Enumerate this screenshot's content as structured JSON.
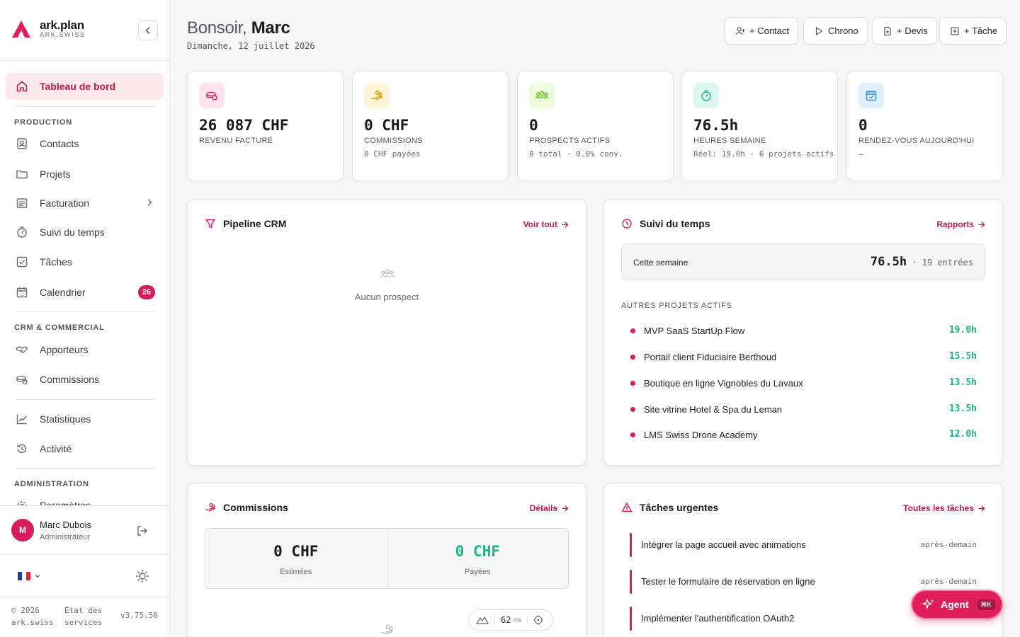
{
  "brand": {
    "name": "ark.plan",
    "sub": "ARK.SWISS"
  },
  "nav": {
    "dashboard": "Tableau de bord",
    "sections": {
      "production": "PRODUCTION",
      "crm": "CRM & COMMERCIAL",
      "admin": "ADMINISTRATION"
    },
    "contacts": "Contacts",
    "projects": "Projets",
    "billing": "Facturation",
    "time": "Suivi du temps",
    "tasks": "Tâches",
    "calendar": "Calendrier",
    "calendar_badge": "26",
    "referrers": "Apporteurs",
    "commissions": "Commissions",
    "stats": "Statistiques",
    "activity": "Activité",
    "settings": "Paramètres"
  },
  "user": {
    "initial": "M",
    "name": "Marc Dubois",
    "role": "Administrateur"
  },
  "footer": {
    "copyright": "© 2026",
    "domain": "ark.swiss",
    "status1": "État des",
    "status2": "services",
    "version": "v3.75.56"
  },
  "header": {
    "greeting": "Bonsoir,",
    "user_name": "Marc",
    "date": "Dimanche, 12 juillet 2026",
    "buttons": {
      "contact": "+ Contact",
      "chrono": "Chrono",
      "quote": "+ Devis",
      "task": "+ Tâche"
    }
  },
  "kpis": [
    {
      "value": "26 087 CHF",
      "label": "REVENU FACTURÉ",
      "sub": ""
    },
    {
      "value": "0 CHF",
      "label": "COMMISSIONS",
      "sub": "0 CHF payées"
    },
    {
      "value": "0",
      "label": "PROSPECTS ACTIFS",
      "sub": "0 total · 0.0% conv."
    },
    {
      "value": "76.5h",
      "label": "HEURES SEMAINE",
      "sub": "Réel: 19.0h · 6 projets actifs"
    },
    {
      "value": "0",
      "label": "RENDEZ-VOUS AUJOURD'HUI",
      "sub": "—"
    }
  ],
  "pipeline": {
    "title": "Pipeline CRM",
    "link": "Voir tout",
    "empty": "Aucun prospect"
  },
  "time": {
    "title": "Suivi du temps",
    "link": "Rapports",
    "week_label": "Cette semaine",
    "week_hours": "76.5h",
    "week_entries": "· 19 entrées",
    "others_heading": "AUTRES PROJETS ACTIFS",
    "projects": [
      {
        "name": "MVP SaaS StartUp Flow",
        "hours": "19.0h"
      },
      {
        "name": "Portail client Fiduciaire Berthoud",
        "hours": "15.5h"
      },
      {
        "name": "Boutique en ligne Vignobles du Lavaux",
        "hours": "13.5h"
      },
      {
        "name": "Site vitrine Hotel & Spa du Leman",
        "hours": "13.5h"
      },
      {
        "name": "LMS Swiss Drone Academy",
        "hours": "12.0h"
      }
    ]
  },
  "commissions": {
    "title": "Commissions",
    "link": "Détails",
    "estimated_value": "0 CHF",
    "estimated_label": "Estimées",
    "paid_value": "0 CHF",
    "paid_label": "Payées"
  },
  "tasks": {
    "title": "Tâches urgentes",
    "link": "Toutes les tâches",
    "items": [
      {
        "name": "Intégrer la page accueil avec animations",
        "due": "après-demain"
      },
      {
        "name": "Tester le formulaire de réservation en ligne",
        "due": "après-demain"
      },
      {
        "name": "Implémenter l'authentification OAuth2",
        "due": ""
      }
    ]
  },
  "perf": {
    "value": "62",
    "unit": "ms"
  },
  "agent": {
    "label": "Agent",
    "shortcut": "⌘K"
  },
  "colors": {
    "accent": "#d81b5a",
    "success": "#1bb58a",
    "active_bg": "#fbe9ee"
  }
}
